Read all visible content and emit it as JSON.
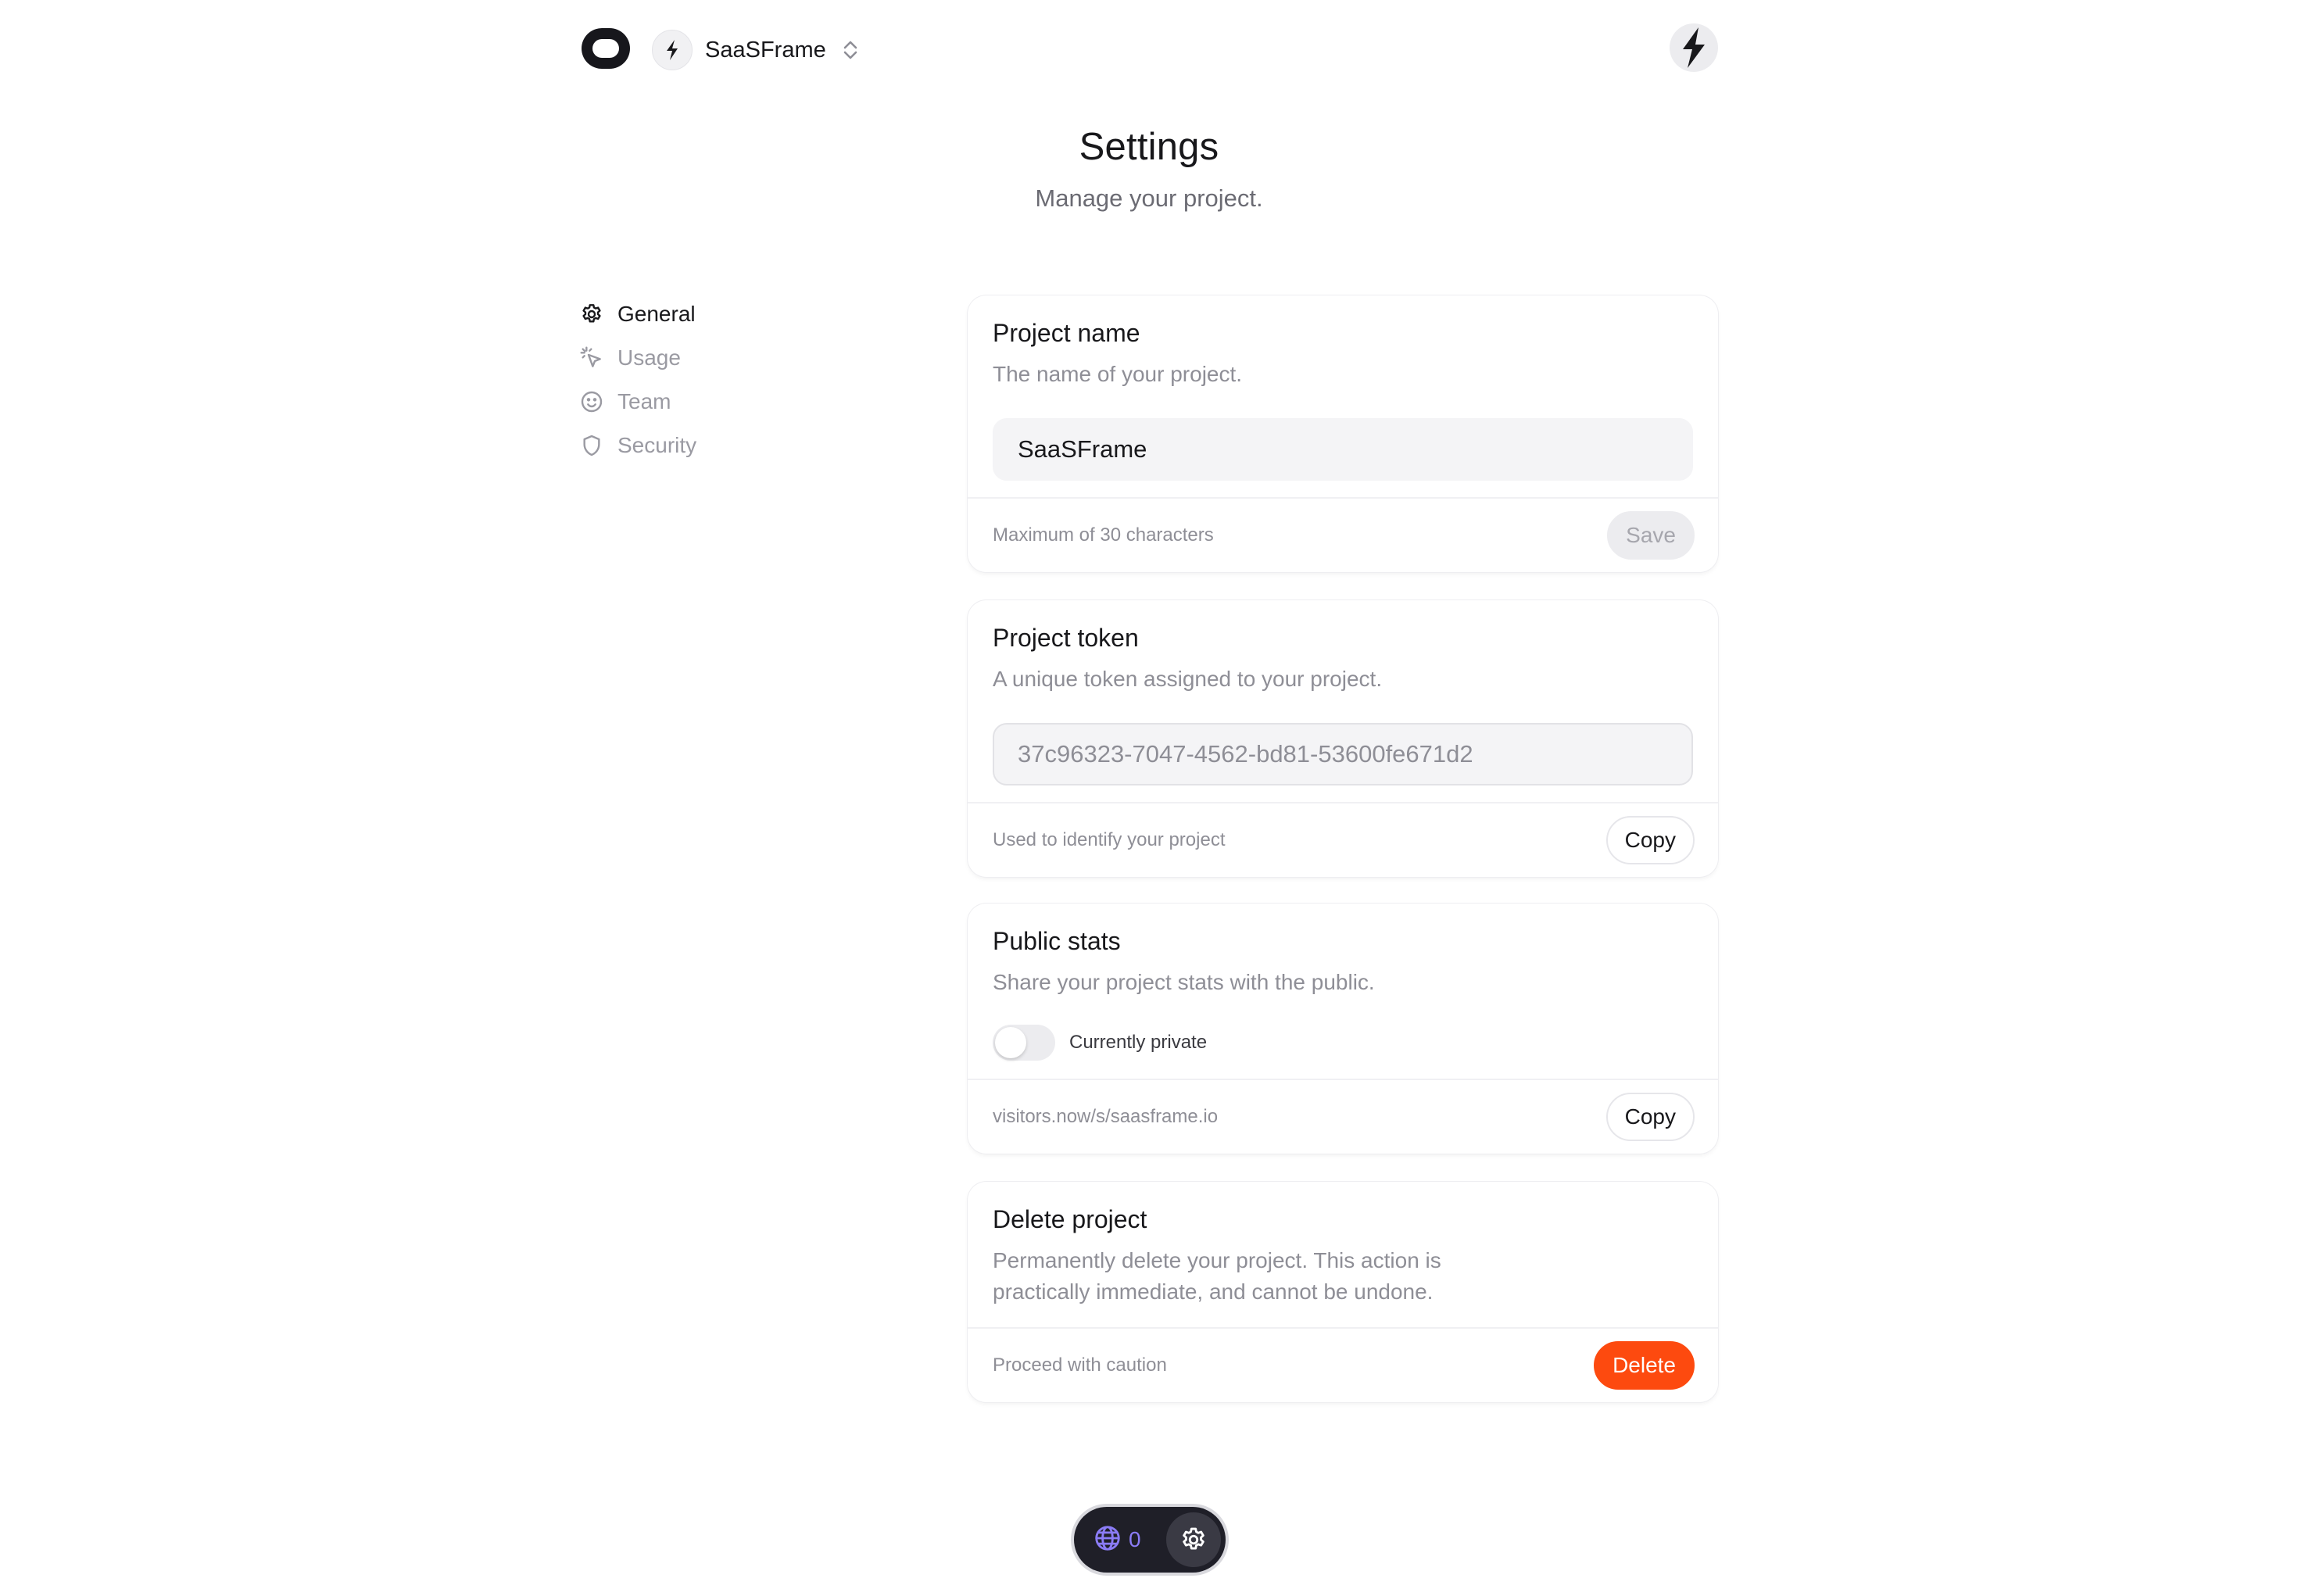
{
  "header": {
    "logo_icon": "app-logo-icon",
    "project_name": "SaaSFrame",
    "project_icon": "bolt-icon",
    "switcher_icon": "chevron-up-down-icon",
    "user_icon": "bolt-icon"
  },
  "page": {
    "title": "Settings",
    "subtitle": "Manage your project."
  },
  "sidebar": {
    "items": [
      {
        "label": "General",
        "icon": "gear-icon",
        "active": true
      },
      {
        "label": "Usage",
        "icon": "cursor-click-icon",
        "active": false
      },
      {
        "label": "Team",
        "icon": "smiley-icon",
        "active": false
      },
      {
        "label": "Security",
        "icon": "shield-icon",
        "active": false
      }
    ]
  },
  "cards": {
    "project_name": {
      "title": "Project name",
      "description": "The name of your project.",
      "input_value": "SaaSFrame",
      "footer_note": "Maximum of 30 characters",
      "button_label": "Save"
    },
    "project_token": {
      "title": "Project token",
      "description": "A unique token assigned to your project.",
      "input_value": "37c96323-7047-4562-bd81-53600fe671d2",
      "footer_note": "Used to identify your project",
      "button_label": "Copy"
    },
    "public_stats": {
      "title": "Public stats",
      "description": "Share your project stats with the public.",
      "toggle_label": "Currently private",
      "toggle_on": false,
      "footer_note": "visitors.now/s/saasframe.io",
      "button_label": "Copy"
    },
    "delete_project": {
      "title": "Delete project",
      "description_line1": "Permanently delete your project. This action is",
      "description_line2": "practically immediate, and cannot be undone.",
      "footer_note": "Proceed with caution",
      "button_label": "Delete"
    }
  },
  "floating_bar": {
    "globe_icon": "globe-icon",
    "visitor_count": "0",
    "settings_icon": "gear-icon"
  },
  "colors": {
    "accent_danger": "#fd4a0f",
    "accent_purple": "#8b7cf6",
    "text_primary": "#18181b",
    "text_muted": "#8e8e96"
  }
}
